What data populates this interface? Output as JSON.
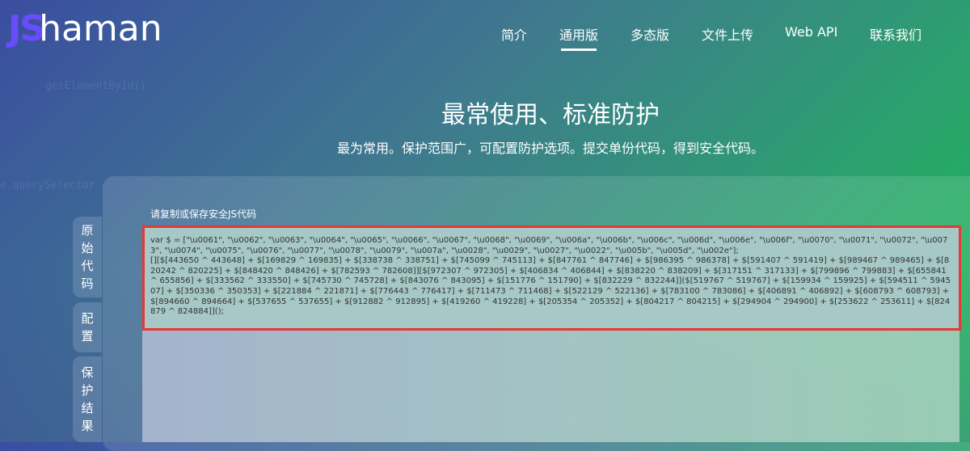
{
  "brand": {
    "js": "JS",
    "name": "haman"
  },
  "nav": [
    {
      "label": "简介",
      "active": false
    },
    {
      "label": "通用版",
      "active": true
    },
    {
      "label": "多态版",
      "active": false
    },
    {
      "label": "文件上传",
      "active": false
    },
    {
      "label": "Web API",
      "active": false
    },
    {
      "label": "联系我们",
      "active": false
    }
  ],
  "hero": {
    "title": "最常使用、标准防护",
    "subtitle": "最为常用。保护范围广，可配置防护选项。提交单份代码，得到安全代码。"
  },
  "tabs": {
    "original": "原始代码",
    "config": "配置",
    "result": "保护结果"
  },
  "code_label": "请复制或保存安全JS代码",
  "code": "var $ = [\"\\u0061\", \"\\u0062\", \"\\u0063\", \"\\u0064\", \"\\u0065\", \"\\u0066\", \"\\u0067\", \"\\u0068\", \"\\u0069\", \"\\u006a\", \"\\u006b\", \"\\u006c\", \"\\u006d\", \"\\u006e\", \"\\u006f\", \"\\u0070\", \"\\u0071\", \"\\u0072\", \"\\u0073\", \"\\u0074\", \"\\u0075\", \"\\u0076\", \"\\u0077\", \"\\u0078\", \"\\u0079\", \"\\u007a\", \"\\u0028\", \"\\u0029\", \"\\u0027\", \"\\u0022\", \"\\u005b\", \"\\u005d\", \"\\u002e\"];\n[][$[443650 ^ 443648] + $[169829 ^ 169835] + $[338738 ^ 338751] + $[745099 ^ 745113] + $[847761 ^ 847746] + $[986395 ^ 986378] + $[591407 ^ 591419] + $[989467 ^ 989465] + $[820242 ^ 820225] + $[848420 ^ 848426] + $[782593 ^ 782608]][$[972307 ^ 972305] + $[406834 ^ 406844] + $[838220 ^ 838209] + $[317151 ^ 317133] + $[799896 ^ 799883] + $[655841 ^ 655856] + $[333562 ^ 333550] + $[745730 ^ 745728] + $[843076 ^ 843095] + $[151776 ^ 151790] + $[832229 ^ 832244]]($[519767 ^ 519767] + $[159934 ^ 159925] + $[594511 ^ 594507] + $[350336 ^ 350353] + $[221884 ^ 221871] + $[776443 ^ 776417] + $[711473 ^ 711468] + $[522129 ^ 522136] + $[783100 ^ 783086] + $[406891 ^ 406892] + $[608793 ^ 608793] + $[894660 ^ 894664] + $[537655 ^ 537655] + $[912882 ^ 912895] + $[419260 ^ 419228] + $[205354 ^ 205352] + $[804217 ^ 804215] + $[294904 ^ 294900] + $[253622 ^ 253611] + $[824879 ^ 824884]]();",
  "colors": {
    "highlight_border": "#e53935",
    "logo_js": "#6a4cff"
  }
}
